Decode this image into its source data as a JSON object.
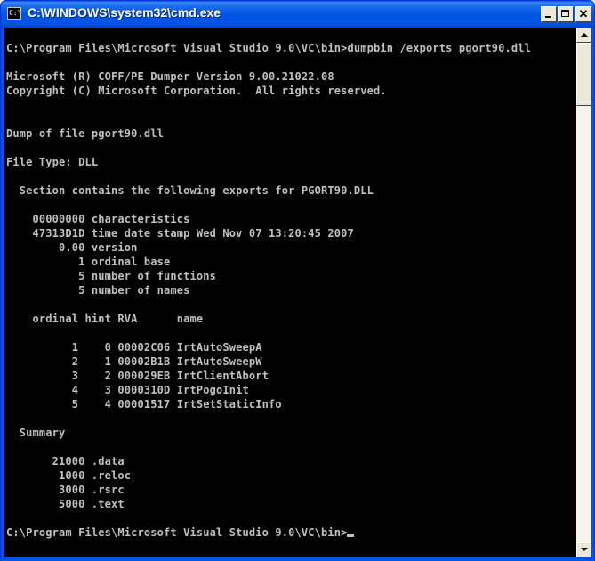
{
  "window": {
    "title": "C:\\WINDOWS\\system32\\cmd.exe",
    "icon": "cmd-icon",
    "icon_text": "C:\\",
    "controls": [
      "minimize-icon",
      "maximize-icon",
      "close-icon"
    ]
  },
  "console": {
    "lines": [
      "C:\\Program Files\\Microsoft Visual Studio 9.0\\VC\\bin>dumpbin /exports pgort90.dll",
      "",
      "Microsoft (R) COFF/PE Dumper Version 9.00.21022.08",
      "Copyright (C) Microsoft Corporation.  All rights reserved.",
      "",
      "",
      "Dump of file pgort90.dll",
      "",
      "File Type: DLL",
      "",
      "  Section contains the following exports for PGORT90.DLL",
      "",
      "    00000000 characteristics",
      "    47313D1D time date stamp Wed Nov 07 13:20:45 2007",
      "        0.00 version",
      "           1 ordinal base",
      "           5 number of functions",
      "           5 number of names",
      "",
      "    ordinal hint RVA      name",
      "",
      "          1    0 00002C06 IrtAutoSweepA",
      "          2    1 00002B1B IrtAutoSweepW",
      "          3    2 000029EB IrtClientAbort",
      "          4    3 0000310D IrtPogoInit",
      "          5    4 00001517 IrtSetStaticInfo",
      "",
      "  Summary",
      "",
      "       21000 .data",
      "        1000 .reloc",
      "        3000 .rsrc",
      "        5000 .text",
      ""
    ],
    "prompt": "C:\\Program Files\\Microsoft Visual Studio 9.0\\VC\\bin>"
  }
}
